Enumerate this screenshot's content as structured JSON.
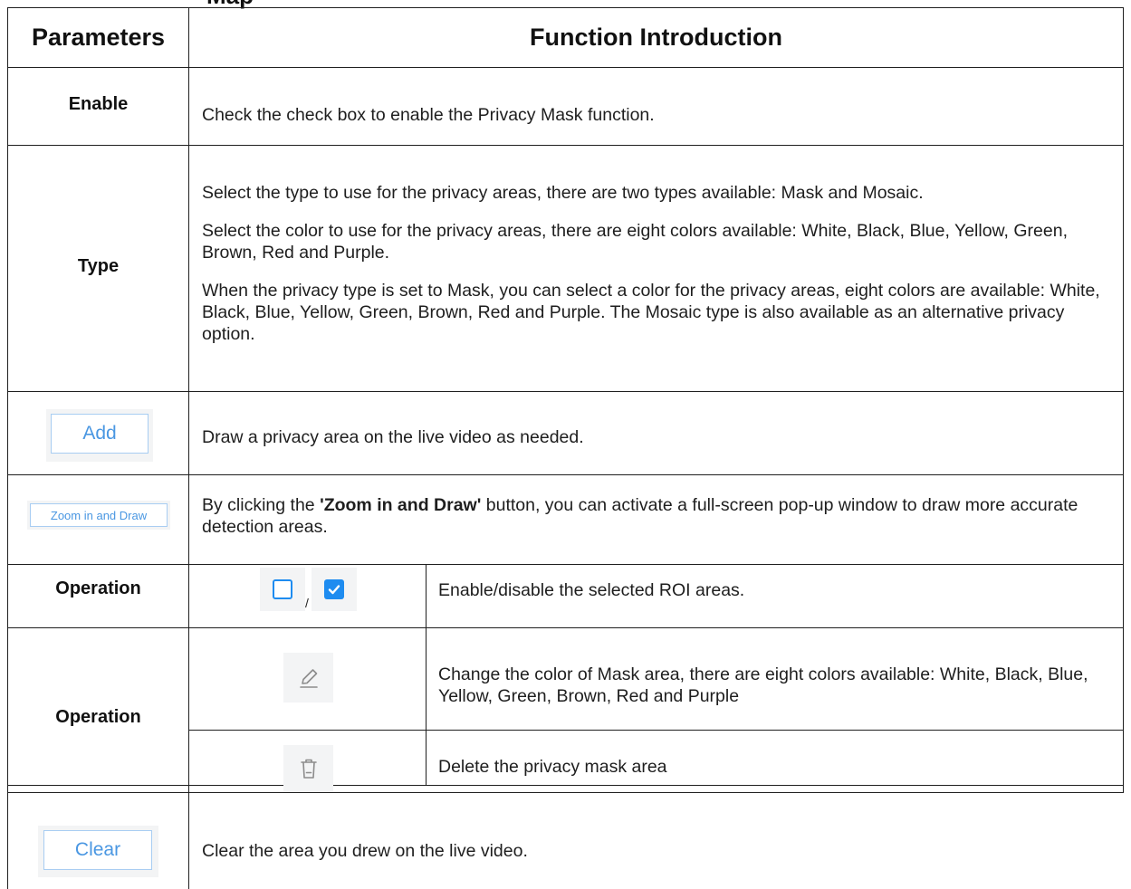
{
  "top_cut_text": "Map",
  "header": {
    "col_params": "Parameters",
    "col_function": "Function Introduction"
  },
  "rows": {
    "enable": {
      "param": "Enable",
      "desc": "Check the check box to enable the Privacy Mask function."
    },
    "type": {
      "param": "Type",
      "desc1": "Select the type to use for the privacy areas, there are two types available: Mask and Mosaic.",
      "desc2": "Select the color to use for the privacy areas, there are eight colors available: White, Black, Blue, Yellow, Green, Brown, Red and Purple.",
      "desc3": "When the privacy type is set to Mask, you can select a color for the privacy areas, eight colors are available: White, Black, Blue, Yellow, Green, Brown, Red and Purple. The Mosaic type is also available as an alternative privacy option."
    },
    "add": {
      "button_label": "Add",
      "desc": "Draw a privacy area on the live video as needed."
    },
    "zoom": {
      "button_label": "Zoom in and Draw",
      "desc_prefix": "By clicking the ",
      "desc_bold": "'Zoom in and Draw'",
      "desc_suffix": " button, you can activate a full-screen pop-up window to draw more accurate detection areas."
    },
    "operation1": {
      "param": "Operation",
      "separator": "/",
      "desc": "Enable/disable the selected ROI areas."
    },
    "operation2": {
      "param": "Operation",
      "edit_desc": "Change the color of Mask area, there are eight colors available: White, Black, Blue, Yellow, Green, Brown, Red and Purple",
      "delete_desc": "Delete the privacy mask area"
    },
    "clear": {
      "button_label": "Clear",
      "desc": "Clear the area you drew on the live video."
    }
  },
  "icons": {
    "checkbox_unchecked": "checkbox-unchecked-icon",
    "checkbox_checked": "checkbox-checked-icon",
    "edit": "pencil-icon",
    "delete": "trash-icon"
  },
  "colors": {
    "button_text": "#4a97e2",
    "button_border": "#a8cdf2",
    "checkbox_checked": "#1e8cf0",
    "icon_gray": "#8c8c8c"
  }
}
